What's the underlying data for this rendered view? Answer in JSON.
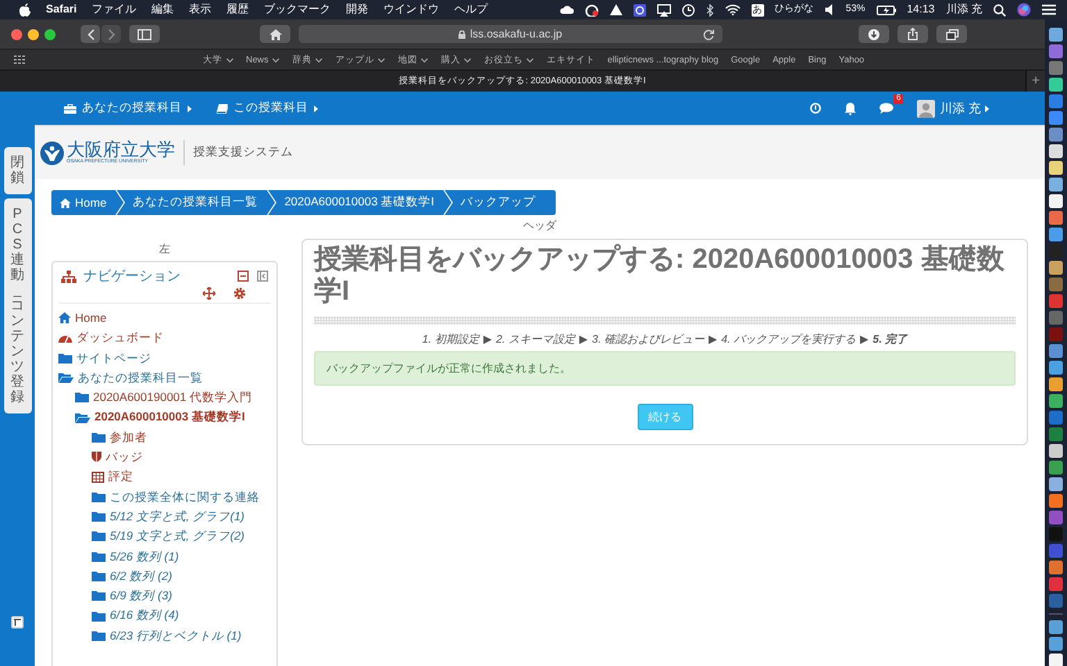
{
  "menubar": {
    "app": "Safari",
    "menus": [
      "ファイル",
      "編集",
      "表示",
      "履歴",
      "ブックマーク",
      "開発",
      "ウインドウ",
      "ヘルプ"
    ],
    "input_key": "あ",
    "input_mode": "ひらがな",
    "battery": "53%",
    "time": "14:13",
    "user": "川添 充"
  },
  "browser": {
    "url": "lss.osakafu-u.ac.jp",
    "bookmarks": [
      {
        "label": "大学",
        "menu": true
      },
      {
        "label": "News",
        "menu": true
      },
      {
        "label": "辞典",
        "menu": true
      },
      {
        "label": "アップル",
        "menu": true
      },
      {
        "label": "地図",
        "menu": true
      },
      {
        "label": "購入",
        "menu": true
      },
      {
        "label": "お役立ち",
        "menu": true
      },
      {
        "label": "エキサイト",
        "menu": false
      },
      {
        "label": "ellipticnews ...tography blog",
        "menu": false
      },
      {
        "label": "Google",
        "menu": false
      },
      {
        "label": "Apple",
        "menu": false
      },
      {
        "label": "Bing",
        "menu": false
      },
      {
        "label": "Yahoo",
        "menu": false
      }
    ],
    "tab_title": "授業科目をバックアップする: 2020A600010003 基礎数学I",
    "new_tab": "+"
  },
  "navbar": {
    "menus": [
      {
        "label": "あなたの授業科目"
      },
      {
        "label": "この授業科目"
      }
    ],
    "message_count": "6",
    "user": "川添 充"
  },
  "side_tabs": [
    {
      "label": "閉鎖"
    },
    {
      "label": "PCS連動_コンテンツ登録"
    }
  ],
  "header": {
    "logo_name": "大阪府立大学",
    "logo_sub": "OSAKA PREFECTURE UNIVERSITY",
    "system": "授業支援システム"
  },
  "breadcrumb": [
    {
      "label": "Home"
    },
    {
      "label": "あなたの授業科目一覧"
    },
    {
      "label": "2020A600010003 基礎数学I"
    },
    {
      "label": "バックアップ"
    }
  ],
  "header_region_label": "ヘッダ",
  "left_region_label": "左",
  "navigation": {
    "title": "ナビゲーション",
    "items": [
      {
        "label": "Home",
        "kind": "home"
      },
      {
        "label": "ダッシュボード",
        "kind": "dashboard"
      },
      {
        "label": "サイトページ",
        "kind": "category",
        "expanded": false
      },
      {
        "label": "あなたの授業科目一覧",
        "kind": "category",
        "expanded": true,
        "children": [
          {
            "label": "2020A600190001 代数学入門",
            "kind": "course",
            "expanded": false,
            "selected": false
          },
          {
            "label": "2020A600010003 基礎数学I",
            "kind": "course",
            "expanded": true,
            "selected": true,
            "children": [
              {
                "label": "参加者",
                "kind": "course-folder"
              },
              {
                "label": "バッジ",
                "kind": "badges"
              },
              {
                "label": "評定",
                "kind": "grades"
              },
              {
                "label": "この授業全体に関する連絡",
                "kind": "category"
              },
              {
                "label": "5/12 文字と式, グラフ(1)",
                "kind": "section"
              },
              {
                "label": "5/19 文字と式, グラフ(2)",
                "kind": "section"
              },
              {
                "label": "5/26 数列 (1)",
                "kind": "section"
              },
              {
                "label": "6/2 数列 (2)",
                "kind": "section"
              },
              {
                "label": "6/9 数列 (3)",
                "kind": "section"
              },
              {
                "label": "6/16 数列 (4)",
                "kind": "section"
              },
              {
                "label": "6/23 行列とベクトル (1)",
                "kind": "section"
              }
            ]
          }
        ]
      }
    ]
  },
  "main": {
    "title": "授業科目をバックアップする: 2020A600010003 基礎数学I",
    "steps": [
      {
        "label": "1. 初期設定",
        "separator": "▶",
        "current": false
      },
      {
        "label": "2. スキーマ設定",
        "separator": "▶",
        "current": false
      },
      {
        "label": "3. 確認およびレビュー",
        "separator": "▶",
        "current": false
      },
      {
        "label": "4. バックアップを実行する",
        "separator": "▶",
        "current": false
      },
      {
        "label": "5. 完了",
        "current": true
      }
    ],
    "message": "バックアップファイルが正常に作成されました。",
    "button": "続ける"
  }
}
